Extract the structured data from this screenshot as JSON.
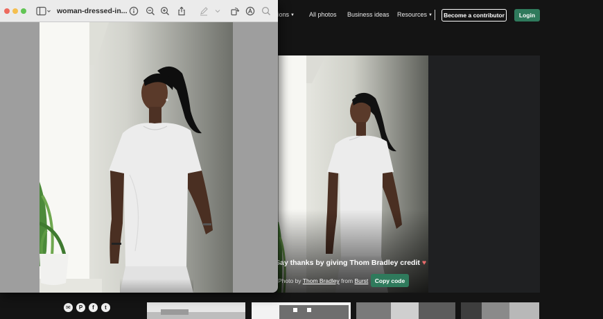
{
  "site": {
    "nav": {
      "partial_label": "tions",
      "all_photos": "All photos",
      "business_ideas": "Business ideas",
      "resources": "Resources",
      "become_contributor": "Become a contributor",
      "login": "Login"
    },
    "credit": {
      "title": "Say thanks by giving Thom Bradley credit",
      "photo_by": "Photo by",
      "photographer": "Thom Bradley",
      "from": "from",
      "source": "Burst",
      "copy_code": "Copy code"
    },
    "social_icons": [
      "mail-icon",
      "pinterest-icon",
      "facebook-icon",
      "twitter-icon"
    ]
  },
  "preview": {
    "window_title": "woman-dressed-in...",
    "icons": [
      "sidebar-toggle-icon",
      "info-icon",
      "zoom-out-icon",
      "zoom-in-icon",
      "share-icon",
      "markup-pen-icon",
      "rotate-icon",
      "annotate-icon",
      "search-icon"
    ]
  },
  "colors": {
    "accent_green": "#2f7a5c",
    "heart": "#e96b6b",
    "site_background": "#141414"
  }
}
